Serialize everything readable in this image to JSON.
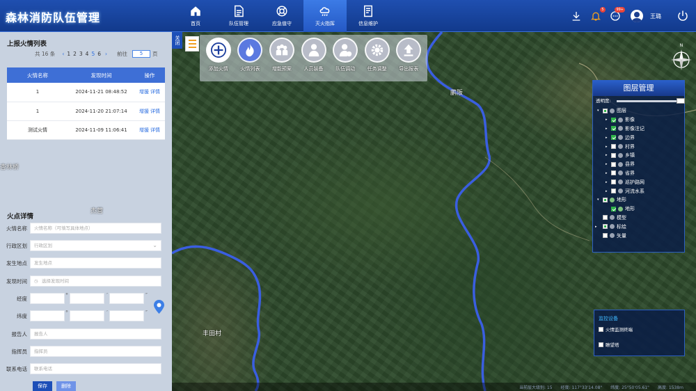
{
  "app_title": "森林消防队伍管理",
  "nav": [
    {
      "label": "首页",
      "icon": "home-icon"
    },
    {
      "label": "队伍管理",
      "icon": "document-icon"
    },
    {
      "label": "应急值守",
      "icon": "lifebuoy-icon"
    },
    {
      "label": "灭火指挥",
      "icon": "cloud-rain-icon"
    },
    {
      "label": "信息维护",
      "icon": "file-list-icon"
    }
  ],
  "header": {
    "bell_badge": "5",
    "chat_badge": "99+",
    "user_name": "王璐"
  },
  "left_panel": {
    "close_label": "关闭",
    "list_title": "上报火情列表",
    "pager": {
      "total": "共 16 条",
      "pages": [
        "1",
        "2",
        "3",
        "4",
        "5",
        "6"
      ],
      "current": "5",
      "goto_label": "前往",
      "goto_value": "5",
      "page_suffix": "页"
    },
    "table": {
      "headers": [
        "火情名称",
        "发现时间",
        "操作"
      ],
      "rows": [
        {
          "name": "1",
          "time": "2024-11-21 08:48:52",
          "op1": "增援",
          "op2": "详情"
        },
        {
          "name": "1",
          "time": "2024-11-20 21:07:14",
          "op1": "增援",
          "op2": "详情"
        },
        {
          "name": "测试火情",
          "time": "2024-11-09 11:06:41",
          "op1": "增援",
          "op2": "详情"
        }
      ]
    },
    "detail_title": "火点详情",
    "form": {
      "fire_name_label": "火情名称",
      "fire_name_placeholder": "火情名称（可填写具体地点）",
      "district_label": "行政区划",
      "district_placeholder": "行政区划",
      "location_label": "发生地点",
      "location_placeholder": "发生地点",
      "time_label": "发现时间",
      "time_placeholder": "选择发现时间",
      "lng_label": "经度",
      "lat_label": "纬度",
      "reporter_label": "报告人",
      "reporter_placeholder": "报告人",
      "commander_label": "指挥员",
      "commander_placeholder": "指挥员",
      "phone_label": "联系电话",
      "phone_placeholder": "联系电话"
    },
    "save_label": "保存",
    "delete_label": "删除"
  },
  "toolbar": [
    {
      "label": "添加火情",
      "icon": "plus-icon"
    },
    {
      "label": "火情列表",
      "icon": "flame-icon"
    },
    {
      "label": "增能预案",
      "icon": "team-icon"
    },
    {
      "label": "人员装备",
      "icon": "person-icon"
    },
    {
      "label": "队伍调动",
      "icon": "user-dispatch-icon"
    },
    {
      "label": "任务调整",
      "icon": "gear-icon"
    },
    {
      "label": "导出报表",
      "icon": "upload-icon"
    }
  ],
  "map_labels": {
    "label_top": "界山",
    "label_mid": "鹏阪",
    "label_village": "丰田村",
    "label_left1": "杏林桥",
    "label_left2": "杰营"
  },
  "layer_panel": {
    "title": "图层管理",
    "opacity_label": "透明度:",
    "items": [
      {
        "label": "图层",
        "level": 1
      },
      {
        "label": "影像",
        "level": 2
      },
      {
        "label": "影像注记",
        "level": 2
      },
      {
        "label": "边界",
        "level": 2
      },
      {
        "label": "村界",
        "level": 2
      },
      {
        "label": "乡镇",
        "level": 2
      },
      {
        "label": "县界",
        "level": 2
      },
      {
        "label": "省界",
        "level": 2
      },
      {
        "label": "巡护路网",
        "level": 2
      },
      {
        "label": "河流水系",
        "level": 2
      },
      {
        "label": "地形",
        "level": 1
      },
      {
        "label": "地形",
        "level": 2
      },
      {
        "label": "模型",
        "level": 0
      },
      {
        "label": "标绘",
        "level": 0
      },
      {
        "label": "矢量",
        "level": 0
      }
    ]
  },
  "monitor": {
    "title": "监控设备",
    "items": [
      "火情监测终端",
      "瞭望塔"
    ]
  },
  "status_bar": {
    "level": "当前层大级别: 15",
    "lng": "经度: 117°33'14.08\"",
    "lat": "纬度: 25°50'05.61\"",
    "height": "高度: 1538m"
  }
}
